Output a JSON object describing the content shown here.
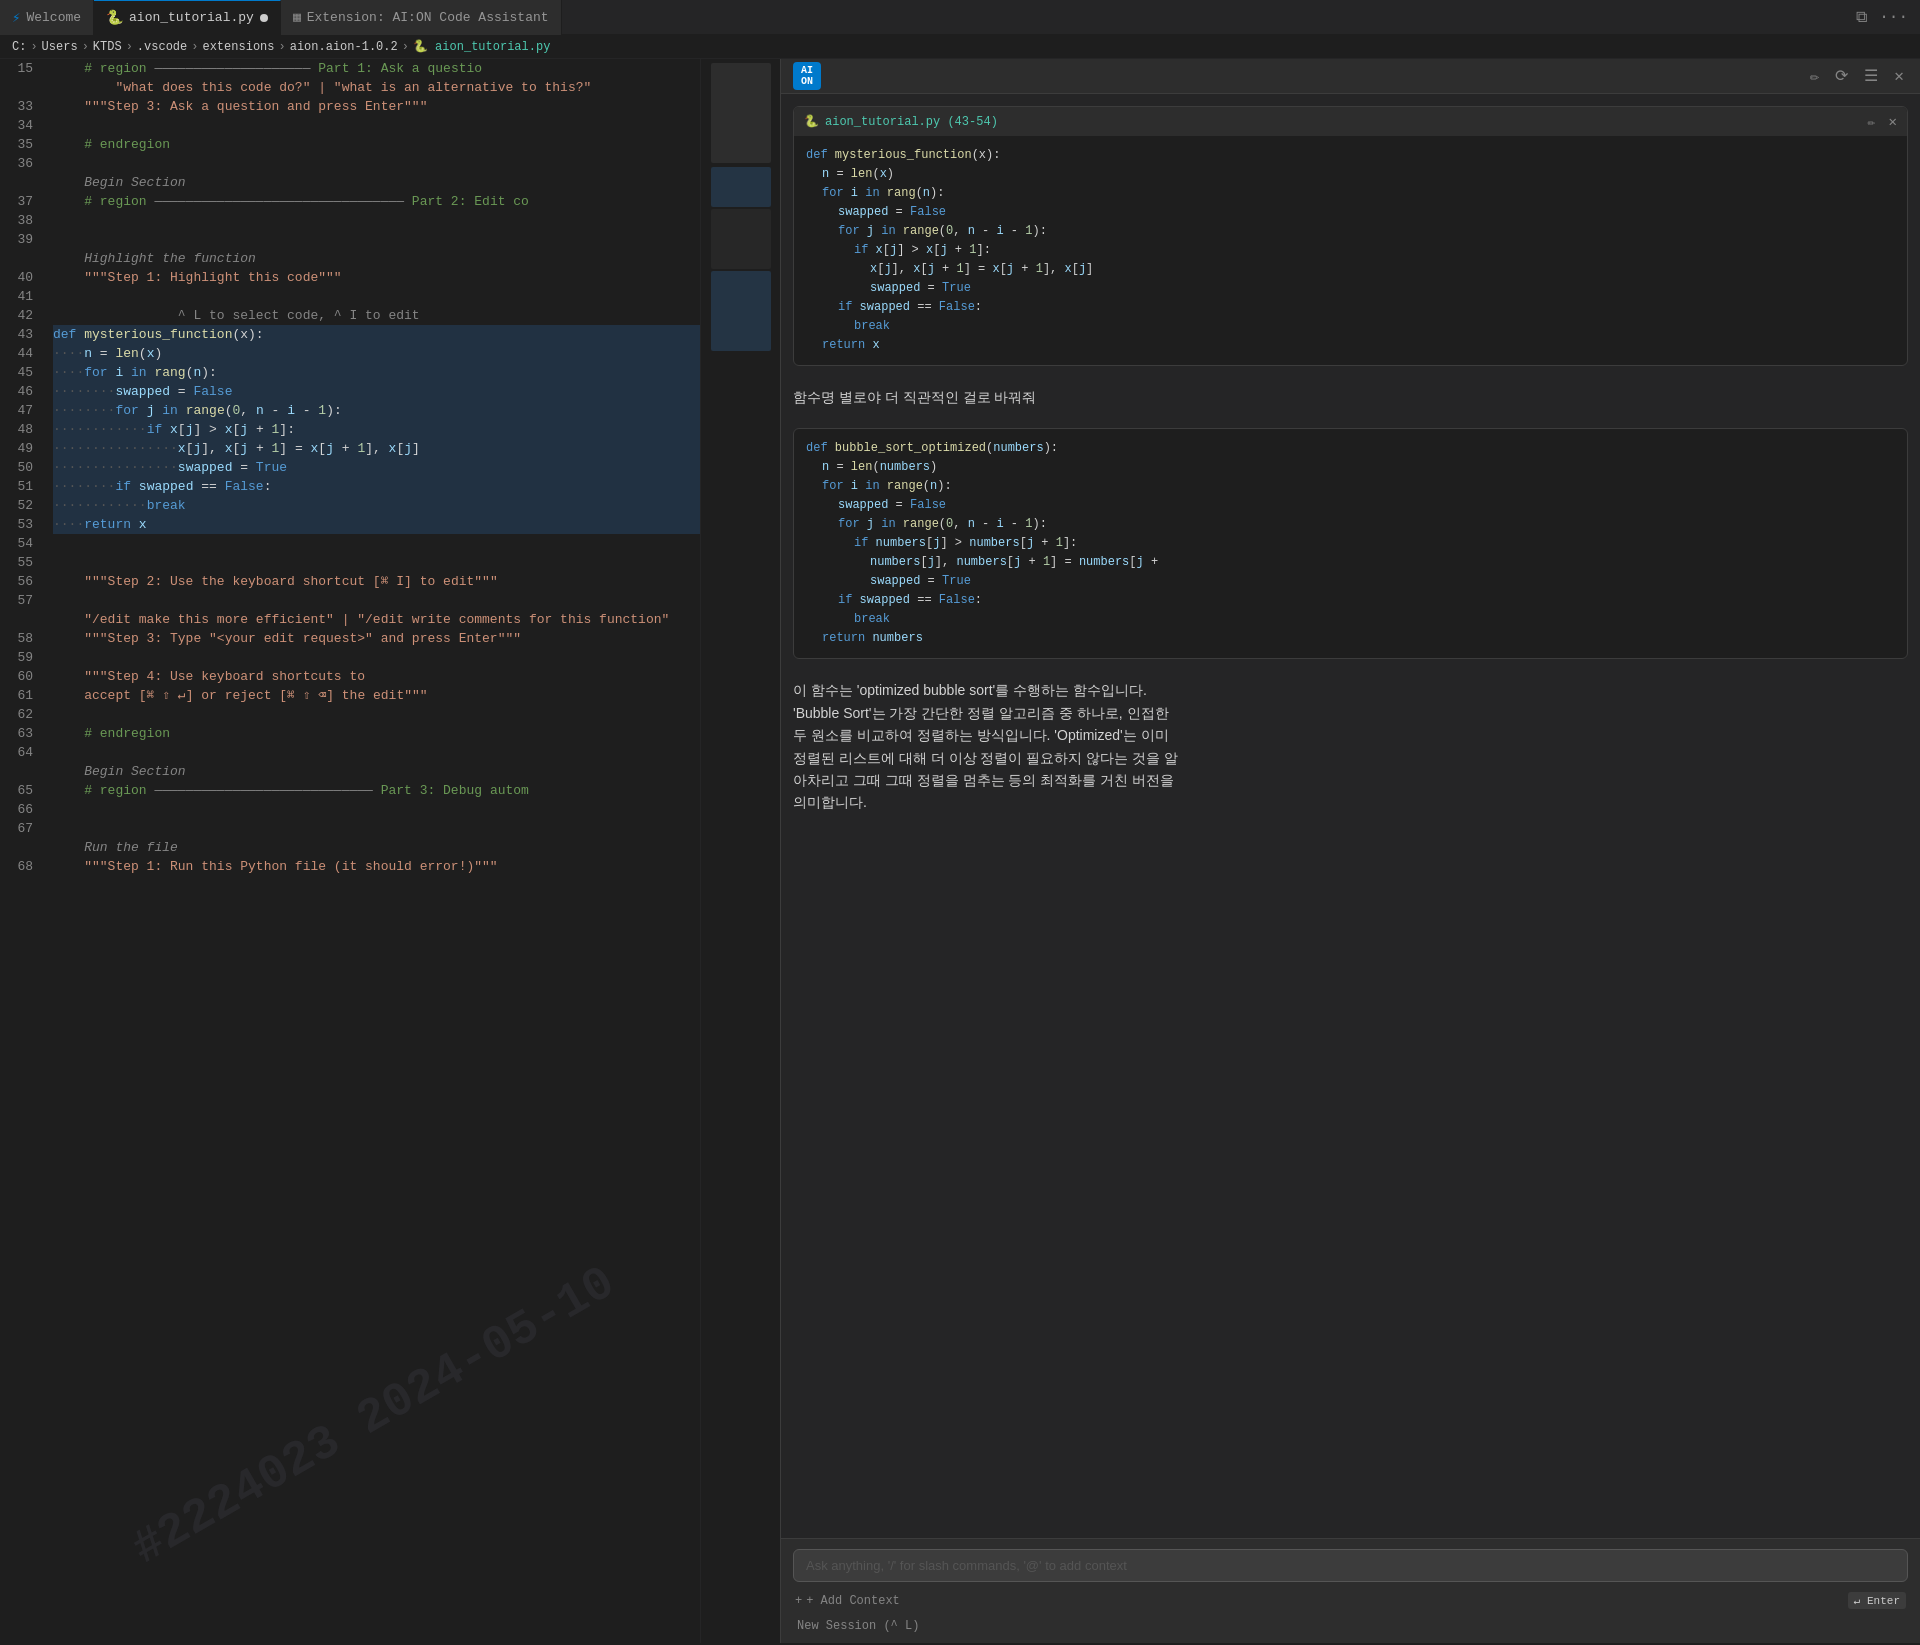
{
  "tabs": [
    {
      "id": "welcome",
      "label": "Welcome",
      "icon": "⚡",
      "active": false
    },
    {
      "id": "aion_tutorial",
      "label": "aion_tutorial.py",
      "icon": "🐍",
      "active": true,
      "modified": true
    },
    {
      "id": "extension",
      "label": "Extension: AI:ON Code Assistant",
      "icon": "▦",
      "active": false
    }
  ],
  "breadcrumb": {
    "parts": [
      "C:",
      "Users",
      "KTDS",
      ".vscode",
      "extensions",
      "aion.aion-1.0.2",
      "aion_tutorial.py"
    ]
  },
  "editor": {
    "lines": [
      {
        "num": "15",
        "content": "    # region ———————————————— Part 1: Ask a questio",
        "type": "region"
      },
      {
        "num": "",
        "content": "        \"what does this code do?\" | \"what is an alternative to this?\"",
        "type": "str"
      },
      {
        "num": "33",
        "content": "    \"\"\"Step 3: Ask a question and press Enter\"\"\"",
        "type": "str"
      },
      {
        "num": "34",
        "content": "",
        "type": "normal"
      },
      {
        "num": "35",
        "content": "    # endregion",
        "type": "comment"
      },
      {
        "num": "36",
        "content": "",
        "type": "normal"
      },
      {
        "num": "",
        "content": "    Begin Section",
        "type": "section"
      },
      {
        "num": "37",
        "content": "    # region ———————————————————————— Part 2: Edit co",
        "type": "region"
      },
      {
        "num": "38",
        "content": "",
        "type": "normal"
      },
      {
        "num": "39",
        "content": "",
        "type": "normal"
      },
      {
        "num": "",
        "content": "    Highlight the function",
        "type": "section"
      },
      {
        "num": "40",
        "content": "    \"\"\"Step 1: Highlight this code\"\"\"",
        "type": "str"
      },
      {
        "num": "41",
        "content": "",
        "type": "normal"
      },
      {
        "num": "42",
        "content": "                ^ L to select code, ^ I to edit",
        "type": "comment"
      },
      {
        "num": "43",
        "content": "def mysterious_function(x):",
        "type": "hl-def"
      },
      {
        "num": "44",
        "content": "    n = len(x)",
        "type": "hl"
      },
      {
        "num": "45",
        "content": "    for i in rang(n):",
        "type": "hl"
      },
      {
        "num": "46",
        "content": "        swapped = False",
        "type": "hl"
      },
      {
        "num": "47",
        "content": "        for j in range(0, n - i - 1):",
        "type": "hl"
      },
      {
        "num": "48",
        "content": "            if x[j] > x[j + 1]:",
        "type": "hl"
      },
      {
        "num": "49",
        "content": "                x[j], x[j + 1] = x[j + 1], x[j]",
        "type": "hl"
      },
      {
        "num": "50",
        "content": "                swapped = True",
        "type": "hl"
      },
      {
        "num": "51",
        "content": "        if swapped == False:",
        "type": "hl"
      },
      {
        "num": "52",
        "content": "            break",
        "type": "hl"
      },
      {
        "num": "53",
        "content": "    return x",
        "type": "hl"
      },
      {
        "num": "54",
        "content": "",
        "type": "normal"
      },
      {
        "num": "55",
        "content": "",
        "type": "normal"
      },
      {
        "num": "56",
        "content": "    \"\"\"Step 2: Use the keyboard shortcut [⌘ I] to edit\"\"\"",
        "type": "str"
      },
      {
        "num": "57",
        "content": "",
        "type": "normal"
      },
      {
        "num": "",
        "content": "    \"/edit make this more efficient\" | \"/edit write comments for this function\"",
        "type": "str"
      },
      {
        "num": "58",
        "content": "    \"\"\"Step 3: Type \"<your edit request>\" and press Enter\"\"\"",
        "type": "str"
      },
      {
        "num": "59",
        "content": "",
        "type": "normal"
      },
      {
        "num": "60",
        "content": "    \"\"\"Step 4: Use keyboard shortcuts to",
        "type": "str"
      },
      {
        "num": "61",
        "content": "    accept [⌘ ⇧ ↵] or reject [⌘ ⇧ ⌫] the edit\"\"\"",
        "type": "str"
      },
      {
        "num": "62",
        "content": "",
        "type": "normal"
      },
      {
        "num": "63",
        "content": "    # endregion",
        "type": "comment"
      },
      {
        "num": "64",
        "content": "",
        "type": "normal"
      },
      {
        "num": "",
        "content": "    Begin Section",
        "type": "section"
      },
      {
        "num": "65",
        "content": "    # region ———————————————————— Part 3: Debug autom",
        "type": "region"
      },
      {
        "num": "66",
        "content": "",
        "type": "normal"
      },
      {
        "num": "67",
        "content": "",
        "type": "normal"
      },
      {
        "num": "",
        "content": "    Run the file",
        "type": "section"
      },
      {
        "num": "68",
        "content": "    \"\"\"Step 1: Run this Python file (it should error!)\"\"\"",
        "type": "str"
      }
    ]
  },
  "ai_panel": {
    "logo_text": "AI\nON",
    "header_title": "",
    "code_card_1": {
      "title": "aion_tutorial.py (43-54)",
      "lines": [
        "def mysterious_function(x):",
        "    n = len(x)",
        "    for i in rang(n):",
        "        swapped = False",
        "        for j in range(0, n - i - 1):",
        "            if x[j] > x[j + 1]:",
        "                x[j], x[j + 1] = x[j + 1], x[j]",
        "                swapped = True",
        "        if swapped == False:",
        "            break",
        "    return x"
      ]
    },
    "description_1": "함수명 별로야 더 직관적인 걸로 바꿔줘",
    "code_card_2": {
      "title": "",
      "lines": [
        "def bubble_sort_optimized(numbers):",
        "    n = len(numbers)",
        "    for i in range(n):",
        "        swapped = False",
        "        for j in range(0, n - i - 1):",
        "            if numbers[j] > numbers[j + 1]:",
        "                numbers[j], numbers[j + 1] = numbers[j +",
        "                swapped = True",
        "        if swapped == False:",
        "            break",
        "    return numbers"
      ]
    },
    "description_2": "이 함수는 'optimized bubble sort'를 수행하는 함수입니다.\n'Bubble Sort'는 가장 간단한 정렬 알고리즘 중 하나로, 인접한\n두 원소를 비교하여 정렬하는 방식입니다. 'Optimized'는 이미\n정렬된 리스트에 대해 더 이상 정렬이 필요하지 않다는 것을 알\n아차리고 그때 그때 정렬을 멈추는 등의 최적화를 거친 버전을\n의미합니다.",
    "input_placeholder": "Ask anything, '/' for slash commands, '@' to add context",
    "add_context_label": "+ Add Context",
    "enter_label": "↵ Enter",
    "new_session_label": "New Session (^ L)"
  },
  "watermark": "#2224023  2024-05-10"
}
